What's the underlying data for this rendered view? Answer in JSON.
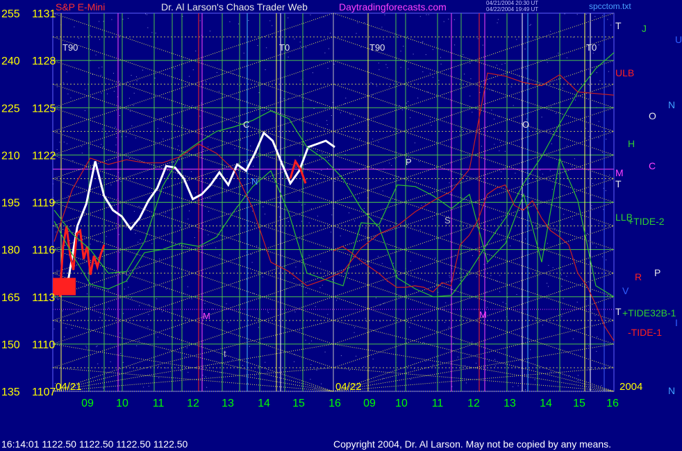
{
  "header": {
    "ticker": "S&P E-Mini",
    "title": "Dr. Al Larson's Chaos Trader Web",
    "site": "Daytradingforecasts.com",
    "stamp": [
      "04/21/2004 20:30 UT",
      "04/22/2004 19:49 UT"
    ],
    "file": "spcctom.txt"
  },
  "footer": {
    "quote": "16:14:01  1122.50 1122.50 1122.50 1122.50",
    "copyright": "Copyright 2004, Dr. Al Larson. May not be copied by any means."
  },
  "colors": {
    "background": "#000080",
    "axis_text": "#ffff00",
    "time_text": "#00ff00",
    "grid_green": "#4cc44c",
    "grid_yellow": "#e8e85a",
    "red_bar": "#ff2020",
    "white_bar": "#ffffff"
  },
  "chart_data": {
    "type": "line",
    "ylim": [
      1107,
      1131
    ],
    "left_scale_labels": [
      "255",
      "240",
      "225",
      "210",
      "195",
      "180",
      "165",
      "150",
      "135"
    ],
    "price_labels": [
      "1131",
      "1128",
      "1125",
      "1122",
      "1119",
      "1116",
      "1113",
      "1110",
      "1107"
    ],
    "day_labels": [
      "04/21",
      "04/22"
    ],
    "year_label": "2004",
    "x_hour_labels": [
      "09",
      "10",
      "11",
      "12",
      "13",
      "14",
      "15",
      "16",
      "09",
      "10",
      "11",
      "12",
      "13",
      "14",
      "15",
      "16"
    ],
    "chart_annotations": [
      {
        "text": "T90",
        "color": "#e8e8e8"
      },
      {
        "text": "T0",
        "color": "#e8e8e8"
      },
      {
        "text": "T90",
        "color": "#e8e8e8"
      },
      {
        "text": "T0",
        "color": "#e8e8e8"
      },
      {
        "text": "C",
        "color": "#e8e8e8"
      },
      {
        "text": "N",
        "color": "#40a0ff"
      },
      {
        "text": "M",
        "color": "#ff40ff"
      },
      {
        "text": "t",
        "color": "#c0c0c0"
      },
      {
        "text": "P",
        "color": "#e8e8e8"
      },
      {
        "text": "S",
        "color": "#c0c0c0"
      },
      {
        "text": "O",
        "color": "#e8e8e8"
      },
      {
        "text": "M",
        "color": "#ff40ff"
      }
    ],
    "right_labels": [
      {
        "text": "T",
        "color": "#e8e8e8"
      },
      {
        "text": "J",
        "color": "#30d030"
      },
      {
        "text": "U",
        "color": "#3060ff"
      },
      {
        "text": "ULB",
        "color": "#ff2020"
      },
      {
        "text": "N",
        "color": "#40a0ff"
      },
      {
        "text": "O",
        "color": "#e8e8e8"
      },
      {
        "text": "H",
        "color": "#30d030"
      },
      {
        "text": "C",
        "color": "#ff40ff"
      },
      {
        "text": "M",
        "color": "#ff40ff"
      },
      {
        "text": "T",
        "color": "#e8e8e8"
      },
      {
        "text": "LLB",
        "color": "#30d030"
      },
      {
        "text": "+TIDE-2",
        "color": "#30d030"
      },
      {
        "text": "R",
        "color": "#ff2020"
      },
      {
        "text": "P",
        "color": "#e8e8e8"
      },
      {
        "text": "V",
        "color": "#3060ff"
      },
      {
        "text": "T",
        "color": "#e8e8e8"
      },
      {
        "text": "+TIDE32B-1",
        "color": "#30d030"
      },
      {
        "text": "I",
        "color": "#3060ff"
      },
      {
        "text": "-TIDE-1",
        "color": "#ff2020"
      },
      {
        "text": "N",
        "color": "#40a0ff"
      }
    ],
    "series": [
      {
        "color": "#ffffff",
        "values": [
          1113.6,
          1114.2,
          1117.5,
          1118.9,
          1121.6,
          1119.4,
          1118.5,
          1118.1,
          1117.3,
          1118.0,
          1119.1,
          1119.9,
          1121.3,
          1121.2,
          1120.5,
          1119.2,
          1119.5,
          1120.1,
          1120.9,
          1120.1,
          1121.4,
          1121.0,
          1122.1,
          1123.4,
          1122.9,
          1121.5,
          1120.2,
          1121.0,
          1122.5,
          1122.7,
          1122.9,
          1122.5
        ]
      },
      {
        "color": "#ff2020",
        "values": [
          1113.0,
          1116.2,
          1117.5,
          1115.7,
          1114.7,
          1117.0,
          1117.2,
          1115.4,
          1116.2,
          1114.4,
          1115.6,
          1114.9,
          1115.7,
          1116.3
        ]
      },
      {
        "color": "#ff2020",
        "values": [
          1120.5,
          1121.6,
          1121.1,
          1120.2
        ]
      },
      {
        "color": "#30c030",
        "values": [
          1118.5,
          1117.0,
          1116.0,
          1114.5,
          1114.6,
          1116.5,
          1120.0,
          1122.0,
          1122.8,
          1123.5,
          1123.8,
          1124.2,
          1124.8,
          1124.3,
          1122.5,
          1121.7,
          1120.5,
          1118.6,
          1117.4,
          1114.2,
          1113.5,
          1113.0,
          1113.1,
          1114.6,
          1116.4,
          1118.0,
          1120.2,
          1121.9,
          1124.0,
          1126.0,
          1127.5,
          1128.5
        ]
      },
      {
        "color": "#30c030",
        "values": [
          1117.8,
          1115.7,
          1113.8,
          1113.5,
          1114.0,
          1115.8,
          1116.0,
          1116.4,
          1116.2,
          1116.8,
          1118.5,
          1120.0,
          1121.0,
          1118.3,
          1114.5,
          1114.1,
          1113.7,
          1117.7,
          1117.6,
          1120.1,
          1120.0,
          1119.4,
          1118.6,
          1119.5,
          1115.2,
          1116.4,
          1119.5,
          1115.2,
          1121.8,
          1119.1,
          1113.7,
          1113.0
        ]
      },
      {
        "color": "#cc2020",
        "values": [
          1116.5,
          1119.8,
          1121.8,
          1121.4,
          1121.7,
          1121.5,
          1121.5,
          1121.9,
          1122.7,
          1122.1,
          1121.0,
          1118.6,
          1115.2,
          1114.6,
          1113.7,
          1114.1,
          1114.6,
          1116.1,
          1117.0,
          1117.5,
          1118.4,
          1119.1,
          1119.7,
          1121.1,
          1127.2,
          1127.0,
          1126.6,
          1126.4,
          1127.1,
          1126.0,
          1125.9,
          1125.8
        ]
      },
      {
        "color": "#cc2020",
        "values": [
          1115.9,
          1116.2,
          1115.8,
          1115.3,
          1114.9,
          1114.5,
          1114.0,
          1113.6,
          1113.6,
          1113.7,
          1113.6,
          1113.3,
          1113.9,
          1113.7,
          1116.3,
          1116.9,
          1117.9,
          1119.5,
          1119.9,
          1120.1,
          1118.8,
          1118.5,
          1119.1,
          1118.0,
          1117.2,
          1116.8,
          1116.3,
          1114.5,
          1113.7,
          1112.5,
          1111.1,
          1110.2
        ]
      }
    ]
  }
}
